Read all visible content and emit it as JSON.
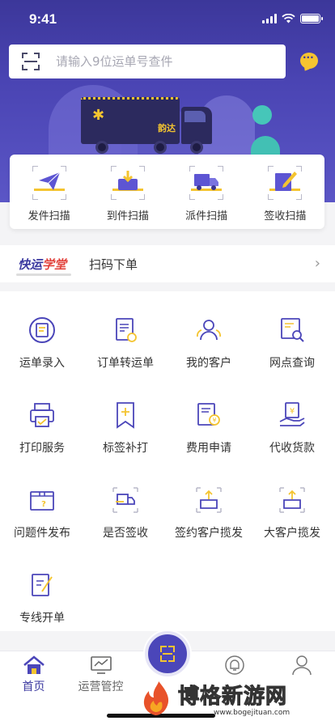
{
  "status": {
    "time": "9:41"
  },
  "search": {
    "placeholder": "请输入9位运单号查件"
  },
  "truck": {
    "brand": "韵达"
  },
  "scan_actions": [
    {
      "label": "发件扫描",
      "icon": "paper-plane-icon"
    },
    {
      "label": "到件扫描",
      "icon": "inbox-arrow-icon"
    },
    {
      "label": "派件扫描",
      "icon": "delivery-truck-icon"
    },
    {
      "label": "签收扫描",
      "icon": "sign-pen-icon"
    }
  ],
  "banner": {
    "logo_main": "快运",
    "logo_accent": "学堂",
    "text": "扫码下单",
    "arrow": "›"
  },
  "grid": [
    {
      "label": "运单录入",
      "icon": "waybill-entry-icon"
    },
    {
      "label": "订单转运单",
      "icon": "order-convert-icon"
    },
    {
      "label": "我的客户",
      "icon": "customers-icon"
    },
    {
      "label": "网点查询",
      "icon": "outlet-search-icon"
    },
    {
      "label": "打印服务",
      "icon": "printer-icon"
    },
    {
      "label": "标签补打",
      "icon": "label-reprint-icon"
    },
    {
      "label": "费用申请",
      "icon": "fee-request-icon"
    },
    {
      "label": "代收货款",
      "icon": "cod-payment-icon"
    },
    {
      "label": "问题件发布",
      "icon": "problem-parcel-icon"
    },
    {
      "label": "是否签收",
      "icon": "sign-check-icon"
    },
    {
      "label": "签约客户揽发",
      "icon": "contract-pickup-icon"
    },
    {
      "label": "大客户揽发",
      "icon": "key-account-pickup-icon"
    },
    {
      "label": "专线开单",
      "icon": "dedicated-line-icon"
    }
  ],
  "tabs": [
    {
      "label": "首页",
      "icon": "home-icon",
      "active": true
    },
    {
      "label": "运营管控",
      "icon": "monitor-icon",
      "active": false
    },
    {
      "label": "",
      "icon": "bell-icon",
      "active": false
    },
    {
      "label": "",
      "icon": "profile-icon",
      "active": false
    }
  ],
  "watermark": {
    "title": "博格新游网",
    "url": "www.bogejituan.com"
  },
  "colors": {
    "primary": "#4b46b9",
    "accent": "#f4c430",
    "header": "#3c379a"
  }
}
